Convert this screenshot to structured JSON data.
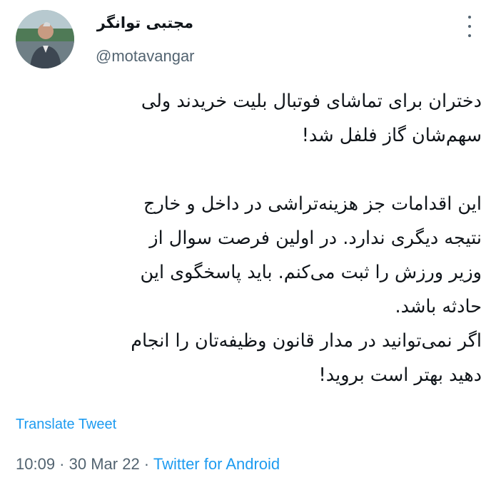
{
  "author": {
    "name": "مجتبی توانگر",
    "handle": "@motavangar"
  },
  "tweet": {
    "lines": [
      "دختران برای تماشای فوتبال بلیت خریدند ولی",
      "سهم‌شان گاز فلفل شد!",
      "",
      "این اقدامات جز هزینه‌تراشی در داخل و خارج",
      "نتیجه دیگری ندارد. در اولین فرصت سوال از",
      "وزیر ورزش را ثبت می‌کنم. باید پاسخگوی این",
      "حادثه باشد.",
      "اگر نمی‌توانید در مدار قانون وظیفه‌تان را انجام",
      "دهید بهتر است بروید!"
    ]
  },
  "actions": {
    "translate_label": "Translate Tweet"
  },
  "meta": {
    "time": "10:09",
    "separator1": " · ",
    "date": "30 Mar 22",
    "separator2": " · ",
    "source": "Twitter for Android"
  },
  "icons": {
    "more": "more-options-icon",
    "avatar": "profile-avatar"
  },
  "colors": {
    "link": "#1d9bf0",
    "secondary": "#536471",
    "text": "#0f1419"
  }
}
